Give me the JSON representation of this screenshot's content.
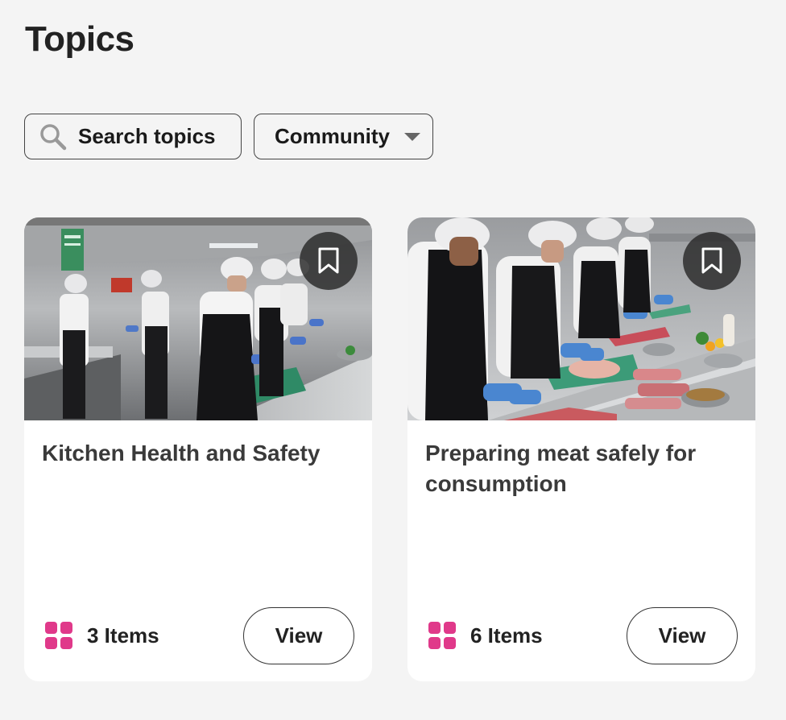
{
  "header": {
    "title": "Topics"
  },
  "filters": {
    "search_label": "Search topics",
    "search_icon": "search-icon",
    "community_label": "Community",
    "community_icon": "chevron-down-icon"
  },
  "cards": [
    {
      "title": "Kitchen Health and Safety",
      "items_label": "3 Items",
      "view_label": "View",
      "image_alt": "Kitchen workers in hairnets preparing food",
      "bookmark_icon": "bookmark-icon",
      "items_icon": "grid-icon"
    },
    {
      "title": "Preparing meat safely for consumption",
      "items_label": "6 Items",
      "view_label": "View",
      "image_alt": "Chefs in blue gloves preparing raw meat",
      "bookmark_icon": "bookmark-icon",
      "items_icon": "grid-icon"
    }
  ],
  "colors": {
    "background": "#f4f4f4",
    "card": "#ffffff",
    "accent": "#e0398a",
    "text": "#222222"
  }
}
